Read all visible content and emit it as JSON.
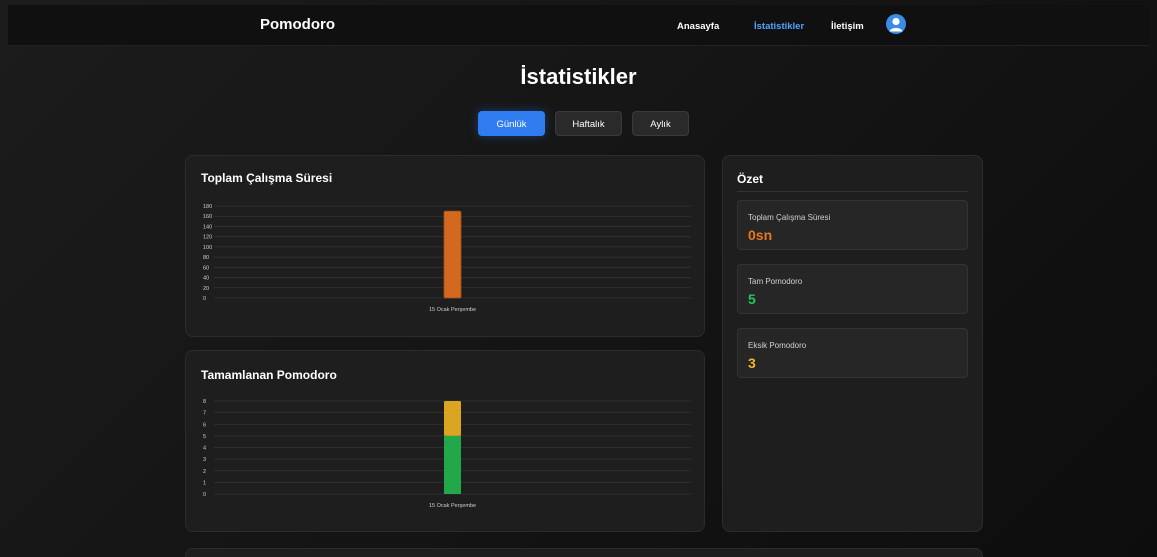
{
  "navbar": {
    "brand": "Pomodoro",
    "links": [
      {
        "label": "Anasayfa",
        "active": false
      },
      {
        "label": "İstatistikler",
        "active": true
      },
      {
        "label": "İletişim",
        "active": false
      }
    ],
    "avatar_icon": "user-icon"
  },
  "page": {
    "title": "İstatistikler",
    "tabs": [
      {
        "label": "Günlük",
        "active": true
      },
      {
        "label": "Haftalık",
        "active": false
      },
      {
        "label": "Aylık",
        "active": false
      }
    ]
  },
  "colors": {
    "accent": "#2f7cf0",
    "orange": "#d2691e",
    "green": "#22a84a",
    "yellow": "#daa520"
  },
  "chart_data": [
    {
      "type": "bar",
      "title": "Toplam Çalışma Süresi",
      "categories": [
        "15 Ocak Perşembe"
      ],
      "values": [
        170
      ],
      "ylim": [
        0,
        180
      ],
      "yticks": [
        0,
        20,
        40,
        60,
        80,
        100,
        120,
        140,
        160,
        180
      ],
      "grid": true,
      "legend": "none",
      "color": "#d2691e"
    },
    {
      "type": "bar",
      "stacked": true,
      "title": "Tamamlanan Pomodoro",
      "categories": [
        "15 Ocak Perşembe"
      ],
      "series": [
        {
          "values": [
            5
          ],
          "color": "#22a84a"
        },
        {
          "values": [
            3
          ],
          "color": "#daa520"
        }
      ],
      "ylim": [
        0,
        8
      ],
      "yticks": [
        0,
        1,
        2,
        3,
        4,
        5,
        6,
        7,
        8
      ],
      "grid": true,
      "legend": "none"
    }
  ],
  "summary": {
    "title": "Özet",
    "items": [
      {
        "label": "Toplam Çalışma Süresi",
        "value": "0sn",
        "color": "#e8781e"
      },
      {
        "label": "Tam Pomodoro",
        "value": "5",
        "color": "#22c55e"
      },
      {
        "label": "Eksik Pomodoro",
        "value": "3",
        "color": "#f5b52a"
      }
    ]
  }
}
